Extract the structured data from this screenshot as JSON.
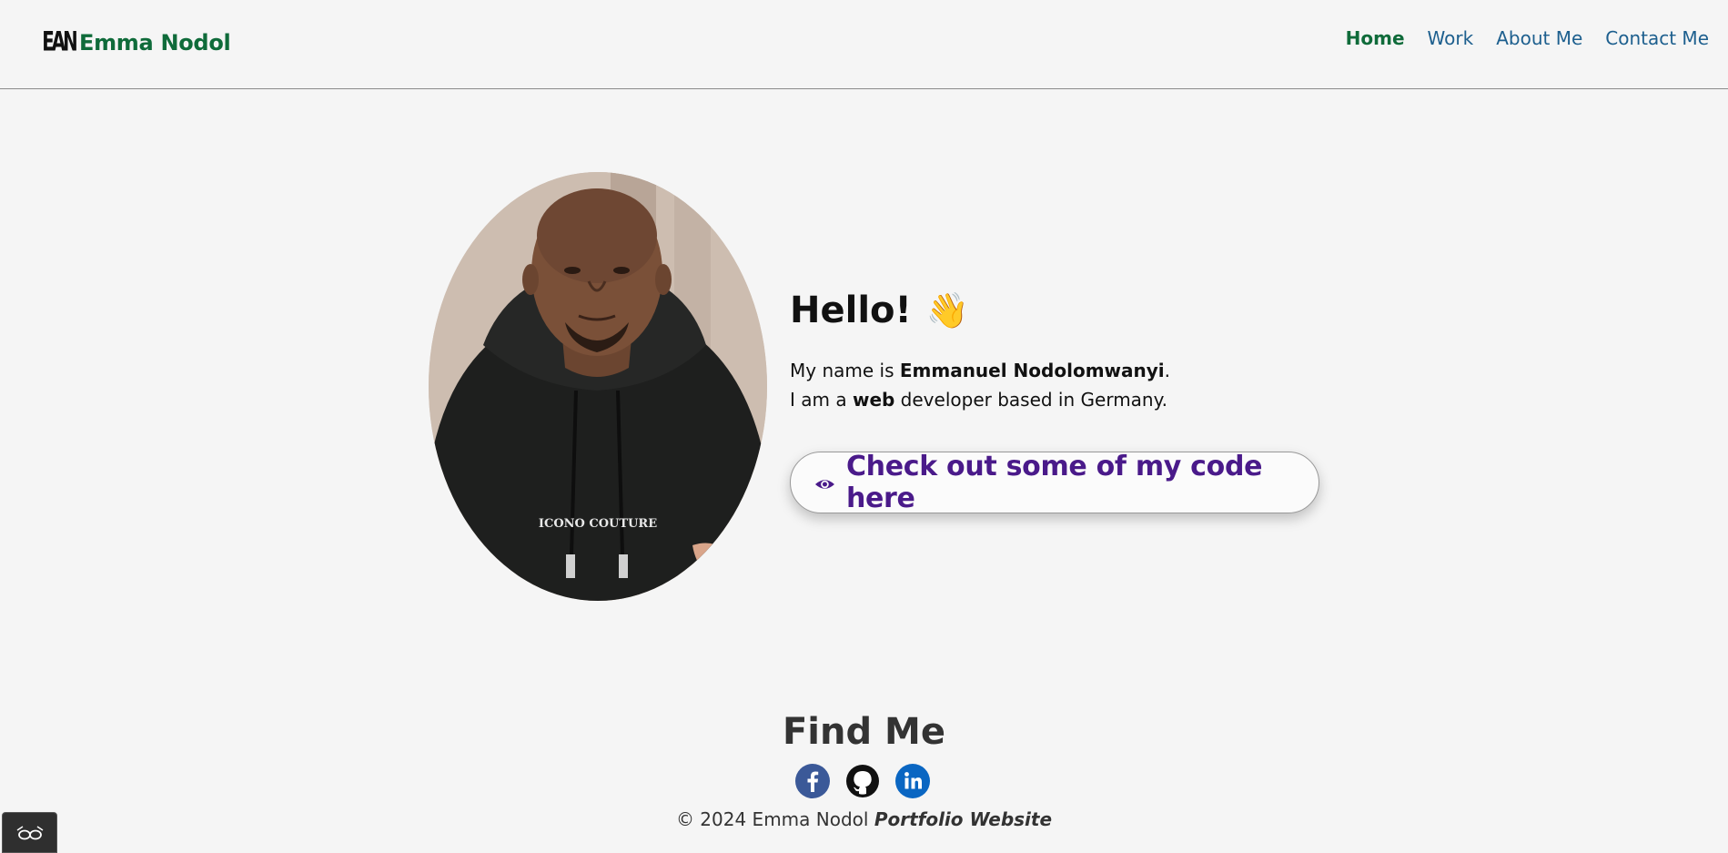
{
  "header": {
    "logo_text": "EAN",
    "brand_name": "Emma Nodol",
    "nav": [
      {
        "label": "Home",
        "active": true
      },
      {
        "label": "Work",
        "active": false
      },
      {
        "label": "About Me",
        "active": false
      },
      {
        "label": "Contact Me",
        "active": false
      }
    ]
  },
  "hero": {
    "greeting": "Hello!",
    "wave_emoji": "👋",
    "bio_line1_prefix": "My name is ",
    "bio_name": "Emmanuel Nodolomwanyi",
    "bio_line1_suffix": ".",
    "bio_line2_prefix": "I am a ",
    "bio_role": "web",
    "bio_line2_suffix": " developer based in Germany.",
    "cta_icon": "eye-icon",
    "cta_label": "Check out some of my code here",
    "portrait_print": "ICONO COUTURE"
  },
  "footer": {
    "title": "Find Me",
    "socials": [
      {
        "name": "facebook-icon",
        "color": "#3b5998"
      },
      {
        "name": "github-icon",
        "color": "#111111"
      },
      {
        "name": "linkedin-icon",
        "color": "#0a66c2"
      }
    ],
    "copyright_prefix": "© 2024 Emma Nodol ",
    "copyright_emphasis": "Portfolio Website"
  },
  "accessibility_button_icon": "glasses-icon",
  "colors": {
    "brand_green": "#0f6b3a",
    "nav_blue": "#1d5f8e",
    "cta_purple": "#4a1a8a",
    "background": "#f5f5f5"
  }
}
